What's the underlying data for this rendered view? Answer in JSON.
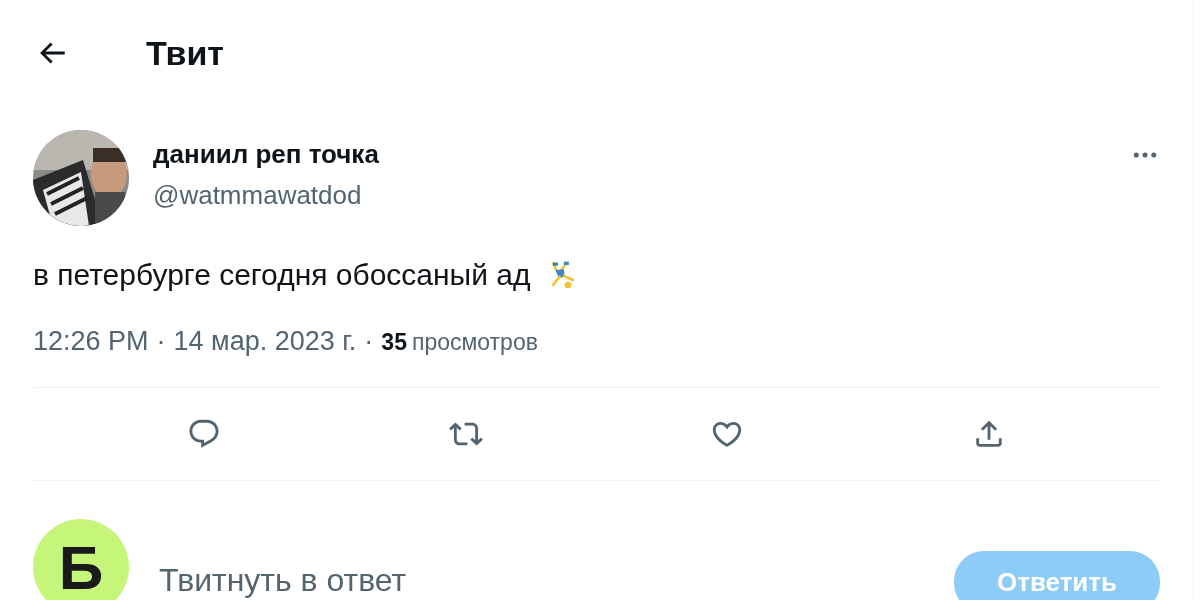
{
  "header": {
    "title": "Твит"
  },
  "tweet": {
    "author_name": "даниил реп точка",
    "handle": "@watmmawatdod",
    "text": "в петербурге сегодня обоссаный ад",
    "time": "12:26 PM",
    "separator": "·",
    "date": "14 мар. 2023 г.",
    "views_count": "35",
    "views_label": "просмотров"
  },
  "reply": {
    "avatar_letter": "Б",
    "placeholder": "Твитнуть в ответ",
    "button": {
      "label": "Ответить",
      "disabled": true
    }
  }
}
